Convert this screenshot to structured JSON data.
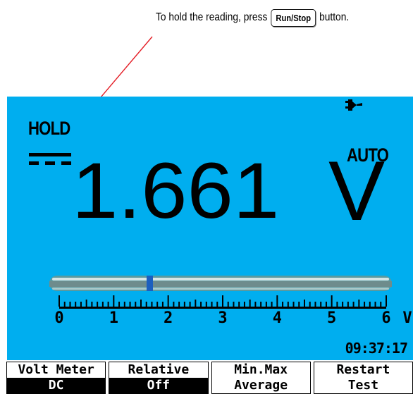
{
  "caption": {
    "before": "To hold the reading, press",
    "key": "Run/Stop",
    "after": "button."
  },
  "screen": {
    "mode": "HOLD",
    "range": "AUTO",
    "reading": "1.661",
    "unit": "V",
    "bar_value": 1.661,
    "scale": {
      "labels": [
        "0",
        "1",
        "2",
        "3",
        "4",
        "5",
        "6"
      ],
      "unit": "V",
      "min": 0,
      "max": 6
    },
    "time": "09:37:17",
    "colors": {
      "background": "#00aeef",
      "bar_fill": "#1b5fbf"
    }
  },
  "softkeys": [
    {
      "line1": "Volt Meter",
      "line2": "DC",
      "inverted": true
    },
    {
      "line1": "Relative",
      "line2": "Off",
      "inverted": true
    },
    {
      "line1": "Min.Max",
      "line2": "Average",
      "inverted": false
    },
    {
      "line1": "Restart",
      "line2": "Test",
      "inverted": false
    }
  ],
  "icons": [
    "arrow-icon",
    "dc-symbol-icon",
    "plug-icon"
  ]
}
